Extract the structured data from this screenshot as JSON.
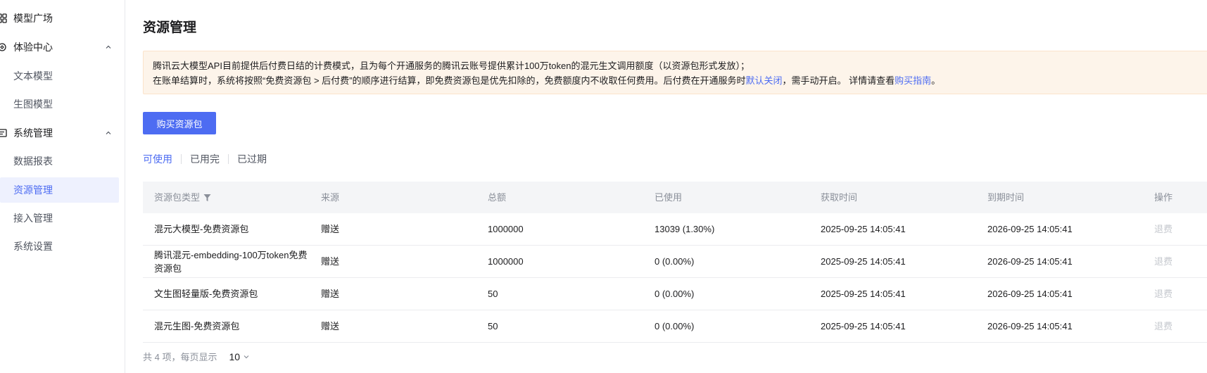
{
  "sidebar": {
    "items": [
      {
        "label": "模型广场",
        "icon": "grid-icon"
      },
      {
        "label": "体验中心",
        "icon": "experience-icon",
        "expanded": true
      },
      {
        "label": "文本模型"
      },
      {
        "label": "生图模型"
      },
      {
        "label": "系统管理",
        "icon": "system-icon",
        "expanded": true
      },
      {
        "label": "数据报表"
      },
      {
        "label": "资源管理",
        "active": true
      },
      {
        "label": "接入管理"
      },
      {
        "label": "系统设置"
      }
    ]
  },
  "page": {
    "title": "资源管理",
    "notice": {
      "line1": "腾讯云大模型API目前提供后付费日结的计费模式，且为每个开通服务的腾讯云账号提供累计100万token的混元生文调用额度（以资源包形式发放）；",
      "line2_a": "在账单结算时，系统将按照“免费资源包 > 后付费”的顺序进行结算，即免费资源包是优先扣除的，免费额度内不收取任何费用。后付费在开通服务时",
      "line2_link1": "默认关闭",
      "line2_b": "，需手动开启。 详情请查看",
      "line2_link2": "购买指南",
      "line2_c": "。"
    },
    "buy_button": "购买资源包",
    "tabs": [
      "可使用",
      "已用完",
      "已过期"
    ],
    "active_tab": "可使用"
  },
  "table": {
    "headers": [
      "资源包类型",
      "来源",
      "总额",
      "已使用",
      "获取时间",
      "到期时间",
      "操作"
    ],
    "rows": [
      {
        "type": "混元大模型-免费资源包",
        "source": "赠送",
        "total": "1000000",
        "used": "13039 (1.30%)",
        "acquired": "2025-09-25 14:05:41",
        "expires": "2026-09-25 14:05:41",
        "action": "退费"
      },
      {
        "type": "腾讯混元-embedding-100万token免费资源包",
        "source": "赠送",
        "total": "1000000",
        "used": "0 (0.00%)",
        "acquired": "2025-09-25 14:05:41",
        "expires": "2026-09-25 14:05:41",
        "action": "退费"
      },
      {
        "type": "文生图轻量版-免费资源包",
        "source": "赠送",
        "total": "50",
        "used": "0 (0.00%)",
        "acquired": "2025-09-25 14:05:41",
        "expires": "2026-09-25 14:05:41",
        "action": "退费"
      },
      {
        "type": "混元生图-免费资源包",
        "source": "赠送",
        "total": "50",
        "used": "0 (0.00%)",
        "acquired": "2025-09-25 14:05:41",
        "expires": "2026-09-25 14:05:41",
        "action": "退费"
      }
    ]
  },
  "pagination": {
    "summary": "共 4 项，每页显示",
    "page_size": "10"
  },
  "colors": {
    "accent": "#4d6cf2",
    "notice_bg": "#fdf4ea",
    "active_nav_bg": "#eef1fe"
  }
}
